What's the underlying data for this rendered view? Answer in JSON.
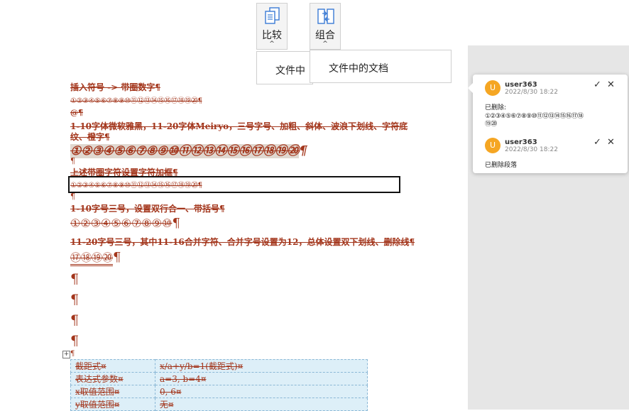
{
  "toolbar": {
    "compare_label": "比较",
    "combine_label": "组合",
    "caret": "^",
    "dropdown_left_text": "文件中",
    "dropdown_right_text": "文件中的文档"
  },
  "document": {
    "line1": "插入符号 -> 带圈数字¶",
    "line2": "①②③④⑤⑥⑦⑧⑨⑩⑪⑫⑬⑭⑮⑯⑰⑱⑲⑳¶",
    "line3": "@¶",
    "line4a": "1-10字体微软雅黑，11-20字体Meiryo，三号字号、加粗、斜体、波浪下划线、字符底",
    "line4b": "纹、橙字¶",
    "line5": "①②③④⑤⑥⑦⑧⑨⑩⑪⑫⑬⑭⑮⑯⑰⑱⑲⑳",
    "line5_pm": "¶",
    "line6": "¶",
    "line7": "上述带圈字符设置字符加框¶",
    "line8": "①②③④⑤⑥⑦⑧⑨⑩⑪⑫⑬⑭⑮⑯⑰⑱⑲⑳¶",
    "line9": "¶",
    "line10": "1-10字号三号，设置双行合一、带括号¶",
    "line11": "①②③④⑤⑥⑦⑧⑨⑩",
    "line11_pm": "¶",
    "line12": "11-20字号三号，其中11-16合并字符、合并字号设置为12，总体设置双下划线、删除线¶",
    "line13": "⑰⑱⑲⑳",
    "line13_pm": "¶",
    "empty_pm": "¶",
    "table_anchor": "¶",
    "table": [
      [
        "截距式¤",
        "x/a+y/b=1(截距式)¤"
      ],
      [
        "表达式参数¤",
        "a=3, b=4¤"
      ],
      [
        "x取值范围¤",
        "0, 6¤"
      ],
      [
        "y取值范围¤",
        "无¤"
      ]
    ]
  },
  "comments": [
    {
      "avatar": "U",
      "user": "user363",
      "date": "2022/8/30 18:22",
      "line1": "已删除:",
      "line2": "①②③④⑤⑥⑦⑧⑨⑩⑪⑫⑬⑭⑮⑯⑰⑱",
      "line3": "⑲⑳",
      "accept": "✓",
      "reject": "✕"
    },
    {
      "avatar": "U",
      "user": "user363",
      "date": "2022/8/30 18:22",
      "line1": "已删除段落",
      "accept": "✓",
      "reject": "✕"
    }
  ]
}
